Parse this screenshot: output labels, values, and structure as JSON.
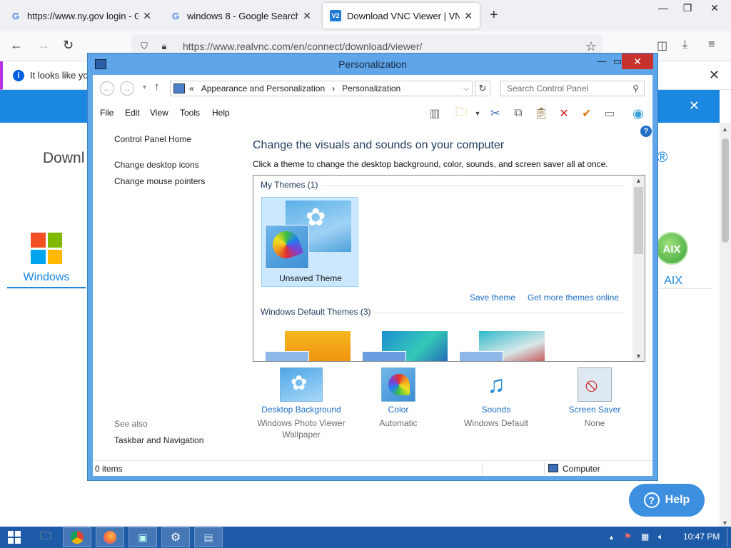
{
  "browser": {
    "tabs": [
      {
        "label": "https://www.ny.gov login - Goo",
        "favicon": "google-g-icon"
      },
      {
        "label": "windows 8 - Google Search",
        "favicon": "google-g-icon"
      },
      {
        "label": "Download VNC Viewer | VNC®",
        "favicon": "vnc-icon"
      }
    ],
    "url": "https://www.realvnc.com/en/connect/download/viewer/",
    "notification": "It looks like you"
  },
  "webpage": {
    "heading_left": "Downl",
    "heading_right": "C®",
    "os_windows": "Windows",
    "os_aix_logo": "AIX",
    "os_aix": "AIX",
    "help_button": "Help"
  },
  "cp": {
    "title": "Personalization",
    "breadcrumb": [
      "«",
      "Appearance and Personalization",
      "›",
      "Personalization"
    ],
    "search_placeholder": "Search Control Panel",
    "menu": [
      "File",
      "Edit",
      "View",
      "Tools",
      "Help"
    ],
    "left_nav": {
      "home": "Control Panel Home",
      "desktop_icons": "Change desktop icons",
      "mouse_pointers": "Change mouse pointers",
      "see_also": "See also",
      "taskbar": "Taskbar and Navigation"
    },
    "heading": "Change the visuals and sounds on your computer",
    "subheading": "Click a theme to change the desktop background, color, sounds, and screen saver all at once.",
    "my_themes": "My Themes (1)",
    "unsaved_theme": "Unsaved Theme",
    "save_theme": "Save theme",
    "get_more": "Get more themes online",
    "default_themes": "Windows Default Themes (3)",
    "bottom": [
      {
        "link": "Desktop Background",
        "value": "Windows Photo Viewer Wallpaper"
      },
      {
        "link": "Color",
        "value": "Automatic"
      },
      {
        "link": "Sounds",
        "value": "Windows Default"
      },
      {
        "link": "Screen Saver",
        "value": "None"
      }
    ],
    "status_items": "0 items",
    "status_location": "Computer"
  },
  "taskbar": {
    "clock": "10:47 PM"
  },
  "colors": {
    "window_frame": "#5fa5e9",
    "link": "#1f6fc5",
    "heading": "#1e395b",
    "taskbar": "#1d5aa8",
    "close_button": "#c8322d"
  }
}
